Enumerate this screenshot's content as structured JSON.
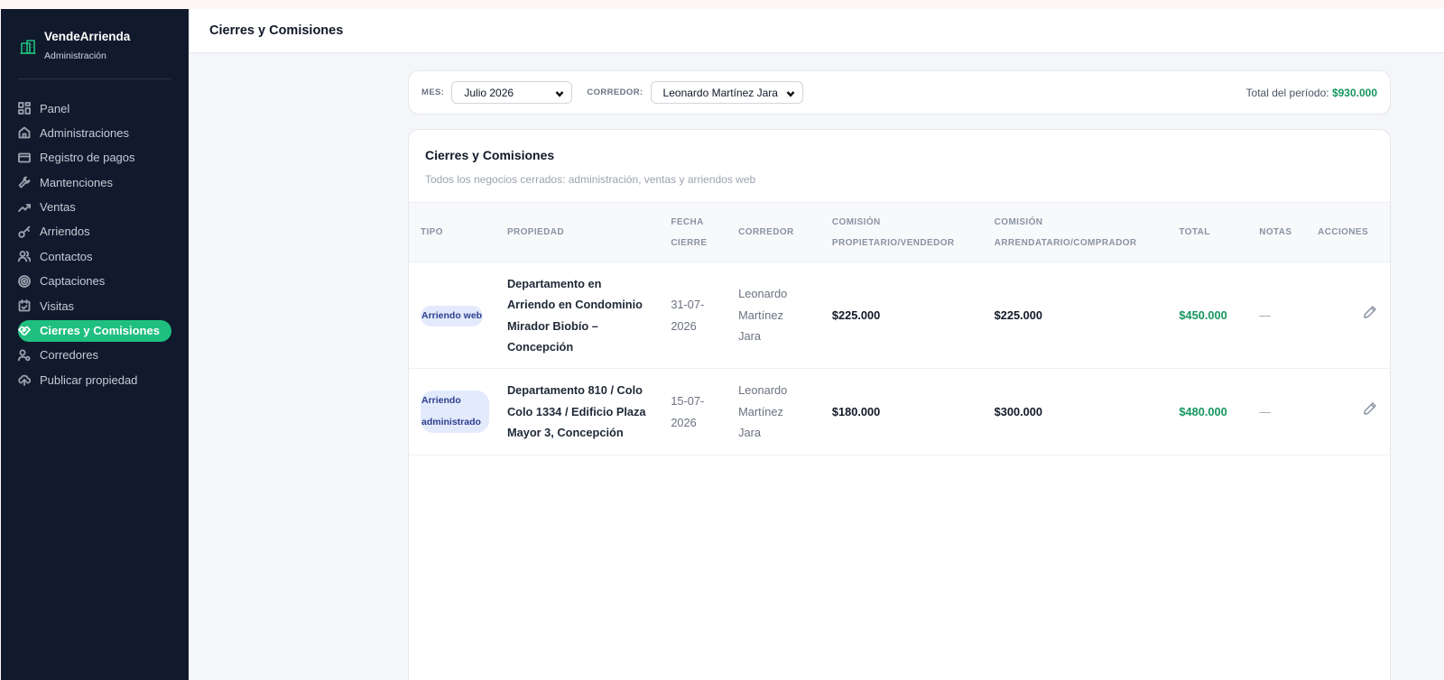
{
  "brand": {
    "name": "VendeArrienda",
    "subtitle": "Administración",
    "icon": "building-icon"
  },
  "sidebar": {
    "items": [
      {
        "label": "Panel",
        "icon": "grid-icon"
      },
      {
        "label": "Administraciones",
        "icon": "home-icon"
      },
      {
        "label": "Registro de pagos",
        "icon": "credit-card-icon"
      },
      {
        "label": "Mantenciones",
        "icon": "wrench-icon"
      },
      {
        "label": "Ventas",
        "icon": "trending-up-icon"
      },
      {
        "label": "Arriendos",
        "icon": "key-icon"
      },
      {
        "label": "Contactos",
        "icon": "users-icon"
      },
      {
        "label": "Captaciones",
        "icon": "target-icon"
      },
      {
        "label": "Visitas",
        "icon": "calendar-check-icon"
      },
      {
        "label": "Cierres y Comisiones",
        "icon": "handshake-icon",
        "active": true
      },
      {
        "label": "Corredores",
        "icon": "user-cog-icon"
      },
      {
        "label": "Publicar propiedad",
        "icon": "cloud-upload-icon"
      }
    ]
  },
  "header": {
    "title": "Cierres y Comisiones"
  },
  "filters": {
    "month_label": "MES:",
    "month_value": "Julio 2026",
    "broker_label": "CORREDOR:",
    "broker_value": "Leonardo Martínez Jara",
    "total_label": "Total del período:",
    "total_value": "$930.000"
  },
  "card": {
    "title": "Cierres y Comisiones",
    "description": "Todos los negocios cerrados: administración, ventas y arriendos web"
  },
  "table": {
    "headers": {
      "tipo": "TIPO",
      "propiedad": "PROPIEDAD",
      "fecha_1": "FECHA",
      "fecha_2": "CIERRE",
      "corredor": "CORREDOR",
      "com_prop_1": "COMISIÓN",
      "com_prop_2": "PROPIETARIO/VENDEDOR",
      "com_arr_1": "COMISIÓN",
      "com_arr_2": "ARRENDATARIO/COMPRADOR",
      "total": "TOTAL",
      "notas": "NOTAS",
      "acciones": "ACCIONES"
    },
    "rows": [
      {
        "tipo_1": "Arriendo web",
        "tipo_2": "",
        "prop_1": "Departamento en",
        "prop_2": "Arriendo en Condominio",
        "prop_3": "Mirador Biobío –",
        "prop_4": "Concepción",
        "fecha_1": "31-07-",
        "fecha_2": "2026",
        "corredor_1": "Leonardo",
        "corredor_2": "Martínez",
        "corredor_3": "Jara",
        "com_prop": "$225.000",
        "com_arr": "$225.000",
        "total": "$450.000",
        "notas": "—"
      },
      {
        "tipo_1": "Arriendo",
        "tipo_2": "administrado",
        "prop_1": "Departamento 810 / Colo",
        "prop_2": "Colo 1334 / Edificio Plaza",
        "prop_3": "Mayor 3, Concepción",
        "prop_4": "",
        "fecha_1": "15-07-",
        "fecha_2": "2026",
        "corredor_1": "Leonardo",
        "corredor_2": "Martínez",
        "corredor_3": "Jara",
        "com_prop": "$180.000",
        "com_arr": "$300.000",
        "total": "$480.000",
        "notas": "—"
      }
    ]
  },
  "colors": {
    "sidebar_bg": "#111a2c",
    "accent": "#1fbf7f",
    "money_green": "#15965e",
    "badge_bg": "#e3eafc"
  }
}
